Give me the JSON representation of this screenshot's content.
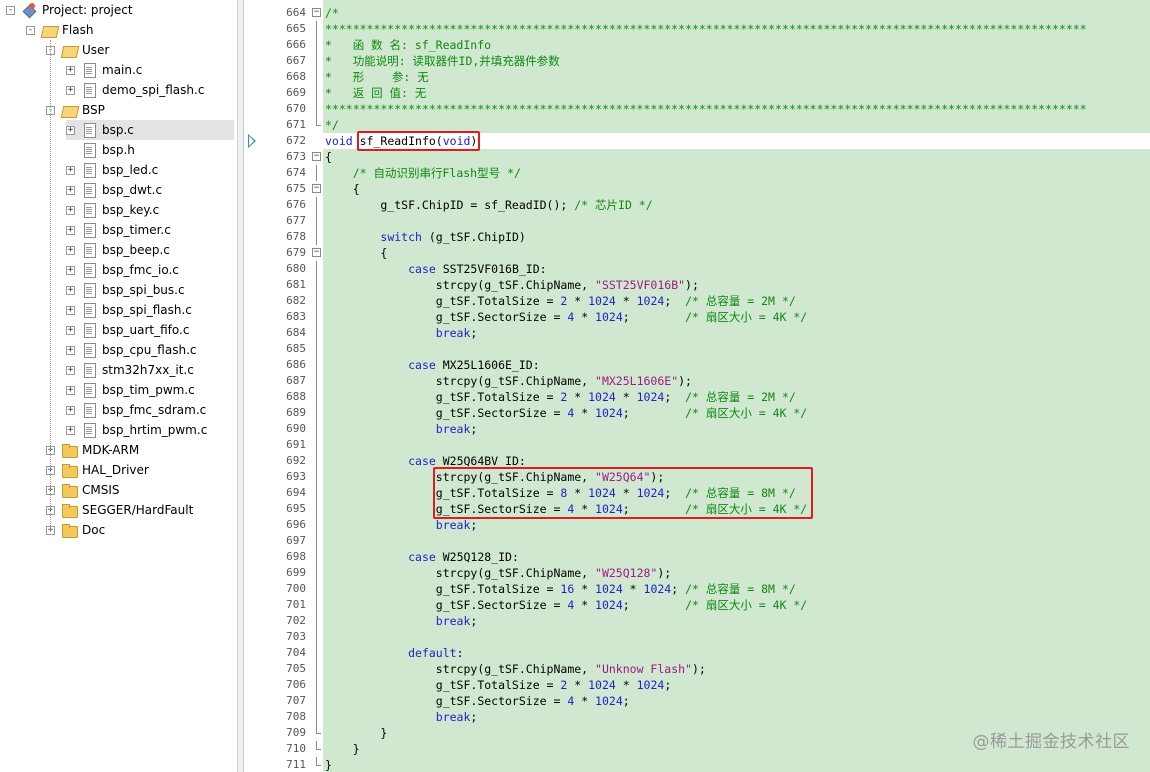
{
  "project_tree": {
    "root": "Project: project",
    "target": "Flash",
    "groups": [
      {
        "name": "User",
        "expanded": true,
        "files": [
          "main.c",
          "demo_spi_flash.c"
        ]
      },
      {
        "name": "BSP",
        "expanded": true,
        "files": [
          "bsp.c",
          "bsp.h",
          "bsp_led.c",
          "bsp_dwt.c",
          "bsp_key.c",
          "bsp_timer.c",
          "bsp_beep.c",
          "bsp_fmc_io.c",
          "bsp_spi_bus.c",
          "bsp_spi_flash.c",
          "bsp_uart_fifo.c",
          "bsp_cpu_flash.c",
          "stm32h7xx_it.c",
          "bsp_tim_pwm.c",
          "bsp_fmc_sdram.c",
          "bsp_hrtim_pwm.c"
        ]
      },
      {
        "name": "MDK-ARM",
        "expanded": false,
        "files": []
      },
      {
        "name": "HAL_Driver",
        "expanded": false,
        "files": []
      },
      {
        "name": "CMSIS",
        "expanded": false,
        "files": []
      },
      {
        "name": "SEGGER/HardFault",
        "expanded": false,
        "files": []
      },
      {
        "name": "Doc",
        "expanded": false,
        "files": []
      }
    ],
    "selected_file": "bsp.c"
  },
  "editor": {
    "current_line": 672,
    "lines": [
      {
        "n": 664,
        "t": "/*",
        "fold": "minus"
      },
      {
        "n": 665,
        "t": "**************************************************************************************************************",
        "fold": "line"
      },
      {
        "n": 666,
        "t": "*   函 数 名: sf_ReadInfo",
        "fold": "line"
      },
      {
        "n": 667,
        "t": "*   功能说明: 读取器件ID,并填充器件参数",
        "fold": "line"
      },
      {
        "n": 668,
        "t": "*   形    参: 无",
        "fold": "line"
      },
      {
        "n": 669,
        "t": "*   返 回 值: 无",
        "fold": "line"
      },
      {
        "n": 670,
        "t": "**************************************************************************************************************",
        "fold": "line"
      },
      {
        "n": 671,
        "t": "*/",
        "fold": "end"
      },
      {
        "n": 672,
        "t": "void sf_ReadInfo(void)",
        "fold": ""
      },
      {
        "n": 673,
        "t": "{",
        "fold": "minus"
      },
      {
        "n": 674,
        "t": "    /* 自动识别串行Flash型号 */",
        "fold": "line"
      },
      {
        "n": 675,
        "t": "    {",
        "fold": "minus"
      },
      {
        "n": 676,
        "t": "        g_tSF.ChipID = sf_ReadID(); /* 芯片ID */",
        "fold": "line"
      },
      {
        "n": 677,
        "t": "",
        "fold": "line"
      },
      {
        "n": 678,
        "t": "        switch (g_tSF.ChipID)",
        "fold": "line"
      },
      {
        "n": 679,
        "t": "        {",
        "fold": "minus"
      },
      {
        "n": 680,
        "t": "            case SST25VF016B_ID:",
        "fold": "line"
      },
      {
        "n": 681,
        "t": "                strcpy(g_tSF.ChipName, \"SST25VF016B\");",
        "fold": "line"
      },
      {
        "n": 682,
        "t": "                g_tSF.TotalSize = 2 * 1024 * 1024;  /* 总容量 = 2M */",
        "fold": "line"
      },
      {
        "n": 683,
        "t": "                g_tSF.SectorSize = 4 * 1024;        /* 扇区大小 = 4K */",
        "fold": "line"
      },
      {
        "n": 684,
        "t": "                break;",
        "fold": "line"
      },
      {
        "n": 685,
        "t": "",
        "fold": "line"
      },
      {
        "n": 686,
        "t": "            case MX25L1606E_ID:",
        "fold": "line"
      },
      {
        "n": 687,
        "t": "                strcpy(g_tSF.ChipName, \"MX25L1606E\");",
        "fold": "line"
      },
      {
        "n": 688,
        "t": "                g_tSF.TotalSize = 2 * 1024 * 1024;  /* 总容量 = 2M */",
        "fold": "line"
      },
      {
        "n": 689,
        "t": "                g_tSF.SectorSize = 4 * 1024;        /* 扇区大小 = 4K */",
        "fold": "line"
      },
      {
        "n": 690,
        "t": "                break;",
        "fold": "line"
      },
      {
        "n": 691,
        "t": "",
        "fold": "line"
      },
      {
        "n": 692,
        "t": "            case W25Q64BV_ID:",
        "fold": "line"
      },
      {
        "n": 693,
        "t": "                strcpy(g_tSF.ChipName, \"W25Q64\");",
        "fold": "line"
      },
      {
        "n": 694,
        "t": "                g_tSF.TotalSize = 8 * 1024 * 1024;  /* 总容量 = 8M */",
        "fold": "line"
      },
      {
        "n": 695,
        "t": "                g_tSF.SectorSize = 4 * 1024;        /* 扇区大小 = 4K */",
        "fold": "line"
      },
      {
        "n": 696,
        "t": "                break;",
        "fold": "line"
      },
      {
        "n": 697,
        "t": "",
        "fold": "line"
      },
      {
        "n": 698,
        "t": "            case W25Q128_ID:",
        "fold": "line"
      },
      {
        "n": 699,
        "t": "                strcpy(g_tSF.ChipName, \"W25Q128\");",
        "fold": "line"
      },
      {
        "n": 700,
        "t": "                g_tSF.TotalSize = 16 * 1024 * 1024; /* 总容量 = 8M */",
        "fold": "line"
      },
      {
        "n": 701,
        "t": "                g_tSF.SectorSize = 4 * 1024;        /* 扇区大小 = 4K */",
        "fold": "line"
      },
      {
        "n": 702,
        "t": "                break;",
        "fold": "line"
      },
      {
        "n": 703,
        "t": "",
        "fold": "line"
      },
      {
        "n": 704,
        "t": "            default:",
        "fold": "line"
      },
      {
        "n": 705,
        "t": "                strcpy(g_tSF.ChipName, \"Unknow Flash\");",
        "fold": "line"
      },
      {
        "n": 706,
        "t": "                g_tSF.TotalSize = 2 * 1024 * 1024;",
        "fold": "line"
      },
      {
        "n": 707,
        "t": "                g_tSF.SectorSize = 4 * 1024;",
        "fold": "line"
      },
      {
        "n": 708,
        "t": "                break;",
        "fold": "line"
      },
      {
        "n": 709,
        "t": "        }",
        "fold": "end"
      },
      {
        "n": 710,
        "t": "    }",
        "fold": "end"
      },
      {
        "n": 711,
        "t": "}",
        "fold": "end"
      }
    ]
  },
  "watermark": "@稀土掘金技术社区",
  "colors": {
    "code_background": "#cfe8cf",
    "keyword": "#1e1ecc",
    "comment": "#0f8a0f",
    "string": "#a01a8a",
    "highlight_box": "#e01c1c"
  }
}
